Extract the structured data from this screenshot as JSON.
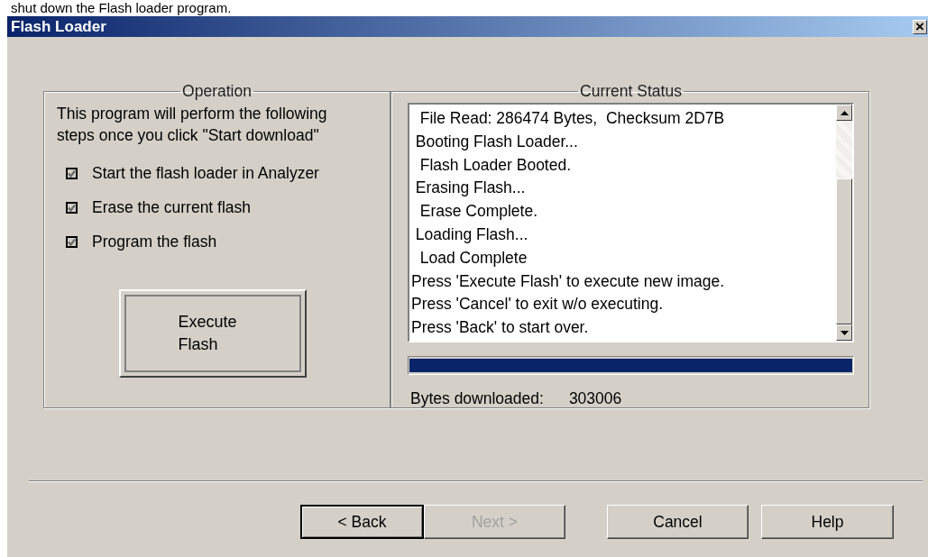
{
  "caption": "shut down the Flash loader program.",
  "window": {
    "title": "Flash Loader",
    "close_glyph": "×"
  },
  "operation": {
    "legend": "Operation",
    "intro": "This program will perform the following steps once you click \"Start download\"",
    "steps": [
      {
        "label": "Start the flash loader in Analyzer",
        "checked": true,
        "disabled": true
      },
      {
        "label": "Erase the current flash",
        "checked": true,
        "disabled": true
      },
      {
        "label": "Program the flash",
        "checked": true,
        "disabled": true
      }
    ],
    "execute_button": "Execute\nFlash"
  },
  "status": {
    "legend": "Current Status",
    "log": [
      "  File Read: 286474 Bytes,  Checksum 2D7B",
      " Booting Flash Loader...",
      "  Flash Loader Booted.",
      " Erasing Flash...",
      "  Erase Complete.",
      " Loading Flash...",
      "  Load Complete",
      "Press 'Execute Flash' to execute new image.",
      "Press 'Cancel' to exit w/o executing.",
      "Press 'Back' to start over."
    ],
    "progress": {
      "level": 1
    },
    "bytes_label": "Bytes downloaded:",
    "bytes_value": "303006"
  },
  "buttons": [
    {
      "label": "< Back",
      "disabled": false,
      "default": true
    },
    {
      "label": "Next >",
      "disabled": true,
      "default": false
    },
    {
      "label": "Cancel",
      "disabled": false,
      "default": false
    },
    {
      "label": "Help",
      "disabled": false,
      "default": false
    }
  ]
}
